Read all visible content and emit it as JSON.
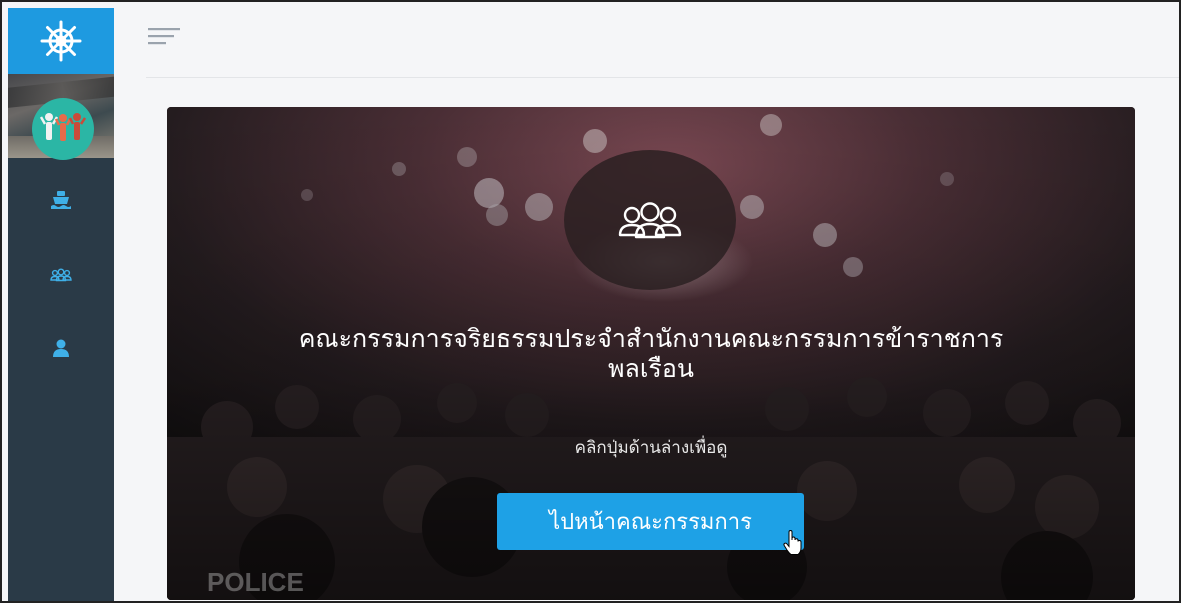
{
  "sidebar": {
    "brand_icon": "ship-wheel-icon",
    "avatar_icon": "people-group-icon",
    "items": [
      {
        "icon": "ship-icon"
      },
      {
        "icon": "users-outline-icon"
      },
      {
        "icon": "user-icon"
      }
    ]
  },
  "topbar": {
    "menu_icon": "hamburger-menu-icon"
  },
  "hero": {
    "center_icon": "users-outline-icon",
    "title_line1": "คณะกรรมการจริยธรรมประจำสำนักงานคณะกรรมการข้าราชการ",
    "title_line2": "พลเรือน",
    "subtitle": "คลิกปุ่มด้านล่างเพื่อดู",
    "button_label": "ไปหน้าคณะกรรมการ",
    "background_text": "POLICE"
  },
  "colors": {
    "brand": "#1e9ae0",
    "sidebar": "#2a3a47",
    "button": "#1ea1e6",
    "avatar": "#2bb6a5",
    "nav_icon": "#3fb0e8"
  }
}
